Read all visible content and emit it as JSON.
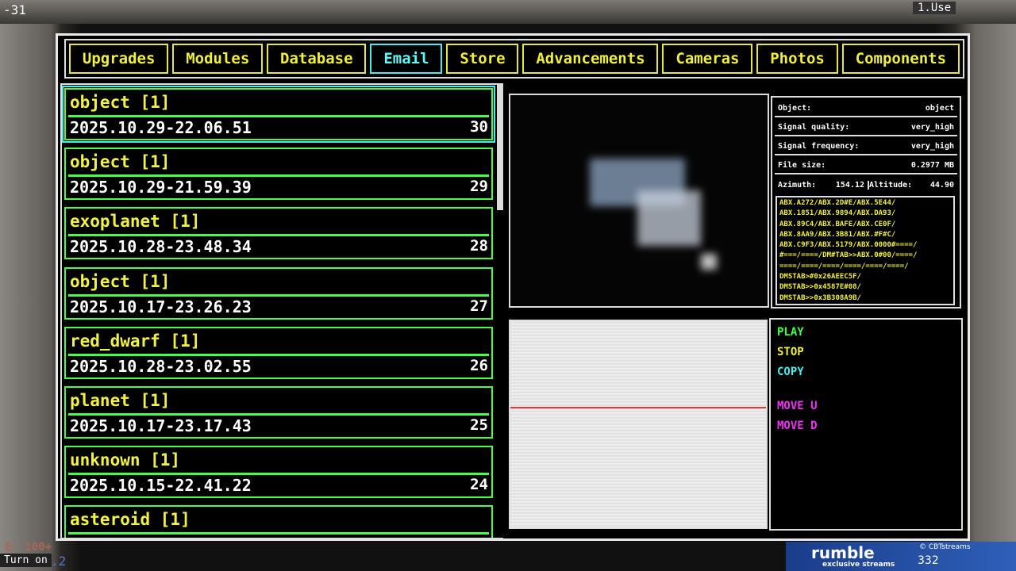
{
  "hud": {
    "top_left": "-31",
    "top_right": "1.Use",
    "turn_on": "Turn on",
    "energy": "E: 100+",
    "bottom_num": ".2"
  },
  "tabs": [
    {
      "label": "Upgrades"
    },
    {
      "label": "Modules"
    },
    {
      "label": "Database"
    },
    {
      "label": "Email",
      "active": true
    },
    {
      "label": "Store"
    },
    {
      "label": "Advancements"
    },
    {
      "label": "Cameras"
    },
    {
      "label": "Photos"
    },
    {
      "label": "Components"
    }
  ],
  "list": [
    {
      "title": "object [1]",
      "date": "2025.10.29-22.06.51",
      "num": "30"
    },
    {
      "title": "object [1]",
      "date": "2025.10.29-21.59.39",
      "num": "29"
    },
    {
      "title": "exoplanet [1]",
      "date": "2025.10.28-23.48.34",
      "num": "28"
    },
    {
      "title": "object [1]",
      "date": "2025.10.17-23.26.23",
      "num": "27"
    },
    {
      "title": "red_dwarf [1]",
      "date": "2025.10.28-23.02.55",
      "num": "26"
    },
    {
      "title": "planet [1]",
      "date": "2025.10.17-23.17.43",
      "num": "25"
    },
    {
      "title": "unknown [1]",
      "date": "2025.10.15-22.41.22",
      "num": "24"
    },
    {
      "title": "asteroid [1]"
    }
  ],
  "info": {
    "object_label": "Object:",
    "object_value": "object",
    "quality_label": "Signal quality:",
    "quality_value": "very_high",
    "freq_label": "Signal frequency:",
    "freq_value": "very_high",
    "size_label": "File size:",
    "size_value": "0.2977 MB",
    "azimuth_label": "Azimuth:",
    "azimuth_value": "154.12",
    "altitude_label": "Altitude:",
    "altitude_value": "44.90",
    "code": "ABX.A272/ABX.2D#E/ABX.5E44/\nABX.1851/ABX.9894/ABX.DA93/\nABX.89C4/ABX.BAFE/ABX.CE0F/\nABX.8AA9/ABX.3B81/ABX.#F#C/\nABX.C9F3/ABX.5179/ABX.0000#====/\n#===/====/DM#TAB>>ABX.0#00/====/\n====/====/====/====/====/====/\nDMSTAB>#0x26AEEC5F/\nDMSTAB>>0x4587E#08/\nDMSTAB>>0x3B308A9B/"
  },
  "controls": {
    "play": "PLAY",
    "stop": "STOP",
    "copy": "COPY",
    "move_up": "MOVE U",
    "move_down": "MOVE D"
  },
  "overlay": {
    "brand": "rumble",
    "tagline": "exclusive streams",
    "channel": "© CBTstreams",
    "viewers": "332"
  },
  "colors": {
    "tab": "#f0f03a",
    "active_tab": "#55ffff",
    "list_border": "#44ff44",
    "play": "#44ff44",
    "stop": "#f0f03a",
    "copy": "#44eeee",
    "move": "#ee33ee"
  }
}
